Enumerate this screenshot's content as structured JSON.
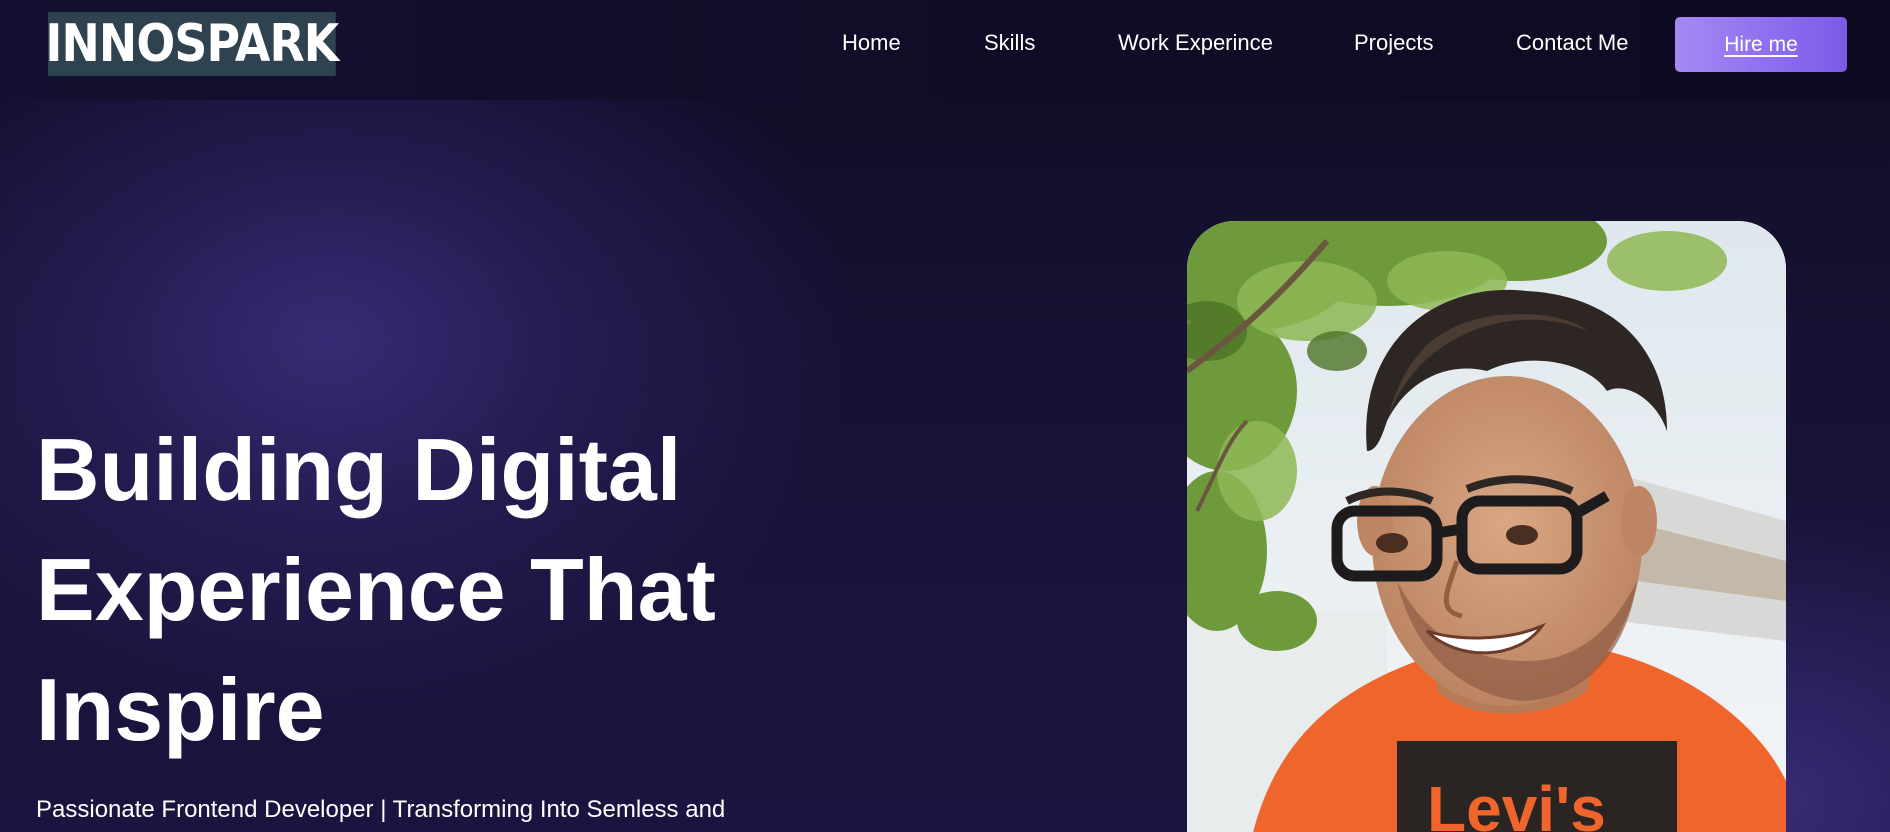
{
  "brand": {
    "logo_text": "INNOSPARK"
  },
  "nav": {
    "items": [
      {
        "label": "Home"
      },
      {
        "label": "Skills"
      },
      {
        "label": "Work Experince"
      },
      {
        "label": "Projects"
      },
      {
        "label": "Contact Me"
      }
    ],
    "cta_label": "Hire me"
  },
  "hero": {
    "title_lines": [
      "Building Digital",
      "Experience That",
      "Inspire"
    ],
    "subtitle": "Passionate Frontend Developer | Transforming Into Semless and"
  },
  "photo": {
    "alt": "profile-photo"
  },
  "colors": {
    "background": "#161233",
    "accent": "#8e6ff0",
    "logo_bg": "#2f4250",
    "text": "#ffffff"
  }
}
